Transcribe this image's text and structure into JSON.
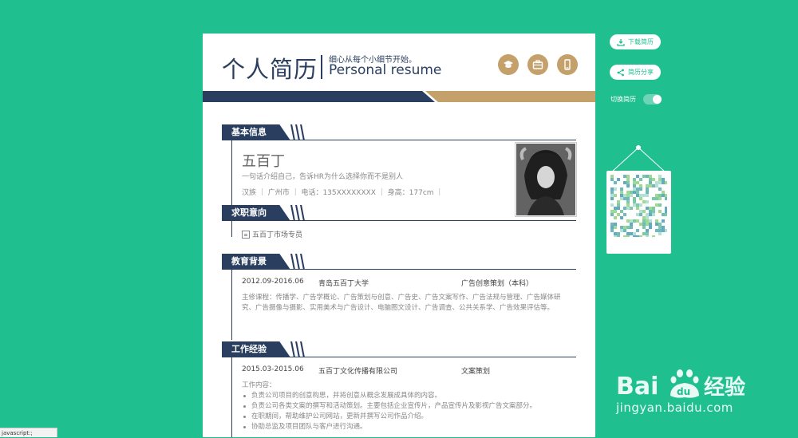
{
  "resume": {
    "title": "个人简历",
    "slogan": "细心从每个小细节开始。",
    "subtitle": "Personal resume",
    "header_icons": [
      "graduation-cap-icon",
      "briefcase-icon",
      "phone-icon"
    ],
    "sections": {
      "basic": "基本信息",
      "intent": "求职意向",
      "education": "教育背景",
      "work": "工作经验"
    },
    "basic": {
      "name": "五百丁",
      "motto": "一句话介绍自己，告诉HR为什么选择你而不是别人",
      "info": "汉族 ｜ 广州市 ｜ 电话：135XXXXXXXX ｜ 身高：177cm ｜"
    },
    "intent_value": "五百丁市场专员",
    "education": {
      "period": "2012.09-2016.06",
      "school": "青岛五百丁大学",
      "major": "广告创意策划（本科）",
      "courses": "主修课程：传播学、广告学概论、广告策划与创意、广告史、广告文案写作、广告法规与管理、广告媒体研究、广告摄像与摄影、实用美术与广告设计、电脑图文设计、广告调查、公共关系学、广告效果评估等。"
    },
    "work": {
      "period": "2015.03-2015.06",
      "company": "五百丁文化传播有限公司",
      "role": "文案策划",
      "content_label": "工作内容：",
      "bullets": [
        "负责公司项目的创意构思，并将创意从概念发展成具体的内容。",
        "负责公司各类文案的撰写和活动策划。主要包括企业宣传片，产品宣传片及影视广告文案部分。",
        "在职期间，帮助维护公司网站，更新并撰写公司作品介绍。",
        "协助总监及项目团队与客户进行沟通。"
      ]
    }
  },
  "controls": {
    "download": "下载简历",
    "share": "简历分享",
    "switch_label": "切换简历"
  },
  "watermark": {
    "logo": "Bai du 经验",
    "url": "jingyan.baidu.com"
  },
  "statusbar": "javascript:;",
  "colors": {
    "background": "#1fbf8f",
    "navy": "#2a3f5f",
    "gold": "#c4a06a"
  }
}
